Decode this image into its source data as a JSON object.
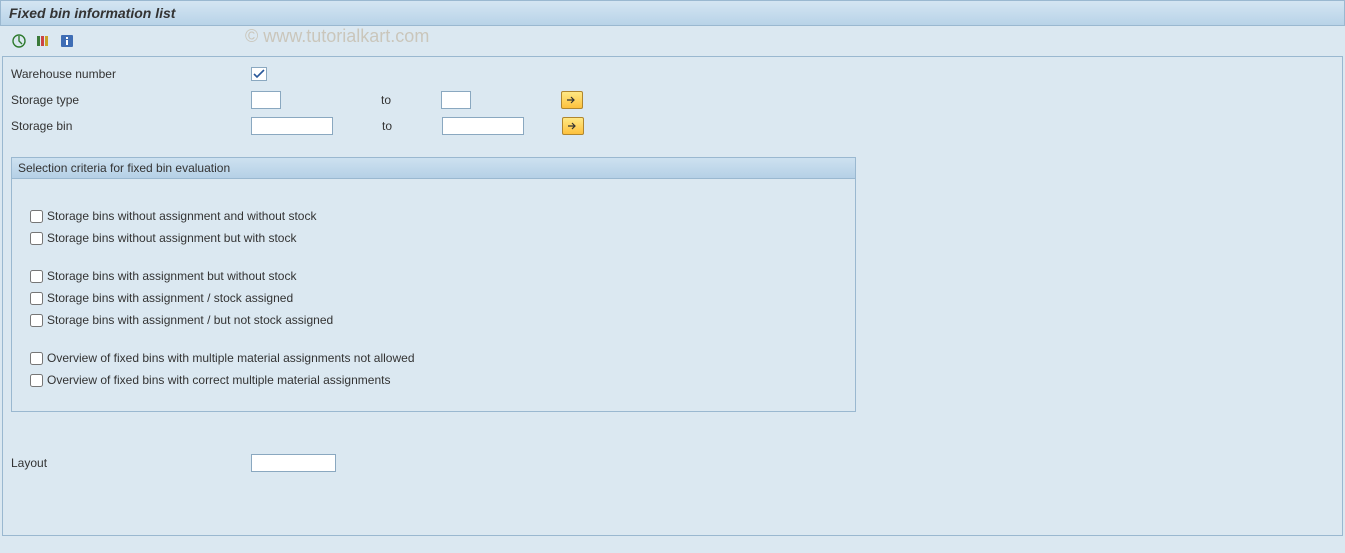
{
  "title": "Fixed bin information list",
  "watermark": "© www.tutorialkart.com",
  "fields": {
    "warehouse_number_label": "Warehouse number",
    "storage_type_label": "Storage type",
    "storage_bin_label": "Storage bin",
    "to_label": "to",
    "layout_label": "Layout",
    "warehouse_number_value": "",
    "storage_type_from": "",
    "storage_type_to": "",
    "storage_bin_from": "",
    "storage_bin_to": "",
    "layout_value": ""
  },
  "group": {
    "header": "Selection criteria for fixed bin evaluation",
    "checkboxes": {
      "c1": "Storage bins without assignment and without stock",
      "c2": "Storage bins without assignment but with stock",
      "c3": "Storage bins with assignment but without stock",
      "c4": "Storage bins with assignment / stock assigned",
      "c5": "Storage bins with assignment / but not stock assigned",
      "c6": "Overview of fixed bins with multiple material assignments not allowed",
      "c7": "Overview of fixed bins with correct multiple material assignments"
    }
  },
  "icons": {
    "execute": "execute-icon",
    "variants": "variants-icon",
    "info": "info-icon"
  }
}
